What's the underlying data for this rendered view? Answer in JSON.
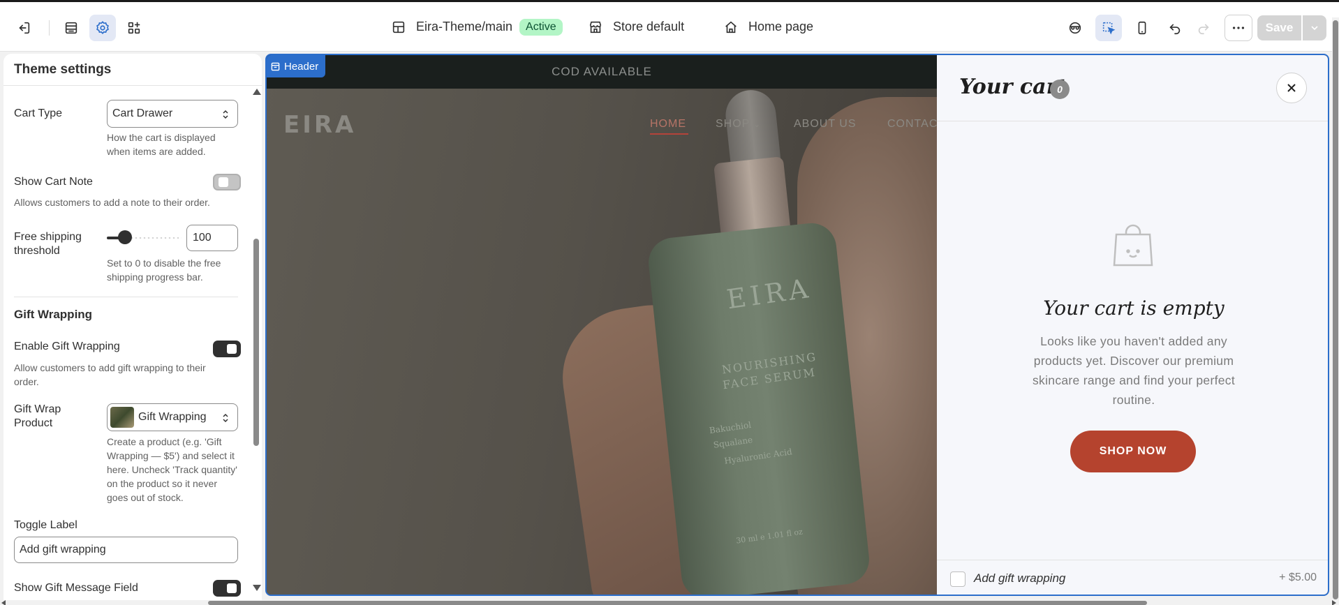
{
  "topbar": {
    "theme_name": "Eira-Theme/main",
    "theme_status": "Active",
    "store": "Store default",
    "template": "Home page",
    "save_label": "Save",
    "icons": [
      "exit-icon",
      "sections-icon",
      "settings-icon",
      "apps-icon",
      "inspector-icon",
      "select-icon",
      "mobile-icon",
      "undo-icon",
      "redo-icon",
      "more-icon",
      "chevron-down-icon"
    ]
  },
  "panel": {
    "title": "Theme settings",
    "cart_type": {
      "label": "Cart Type",
      "value": "Cart Drawer",
      "help": "How the cart is displayed when items are added."
    },
    "show_cart_note": {
      "label": "Show Cart Note",
      "enabled": false,
      "help": "Allows customers to add a note to their order."
    },
    "free_shipping": {
      "label": "Free shipping threshold",
      "value": "100",
      "slider_fraction": 0.25,
      "help": "Set to 0 to disable the free shipping progress bar."
    },
    "gift_section": {
      "heading": "Gift Wrapping",
      "enable": {
        "label": "Enable Gift Wrapping",
        "enabled": true,
        "help": "Allow customers to add gift wrapping to their order."
      },
      "product": {
        "label": "Gift Wrap Product",
        "value": "Gift Wrapping",
        "help": "Create a product (e.g. 'Gift Wrapping — $5') and select it here. Uncheck 'Track quantity' on the product so it never goes out of stock."
      },
      "toggle_label": {
        "label": "Toggle Label",
        "value": "Add gift wrapping"
      },
      "show_message": {
        "label": "Show Gift Message Field",
        "enabled": true
      }
    }
  },
  "preview": {
    "header_tag": "Header",
    "announcement": "COD AVAILABLE",
    "logo": "EIRA",
    "nav": [
      "HOME",
      "SHOP",
      "ABOUT US",
      "CONTACT"
    ],
    "bottle": {
      "brand": "EIRA",
      "line1": "NOURISHING",
      "line2": "FACE SERUM",
      "ing1": "Bakuchiol",
      "ing2": "Squalane",
      "ing3": "Hyaluronic Acid",
      "volume": "30 ml e 1.01 fl oz"
    },
    "cart": {
      "title": "Your cart",
      "count": "0",
      "empty_heading": "Your cart is empty",
      "empty_text": "Looks like you haven't added any products yet. Discover our premium skincare range and find your perfect routine.",
      "shop_button": "SHOP NOW",
      "gift_label": "Add gift wrapping",
      "gift_price": "+ $5.00"
    }
  },
  "colors": {
    "accent": "#2c6ecb",
    "active_badge": "#b3f5c6",
    "shop_button": "#b5432e"
  }
}
